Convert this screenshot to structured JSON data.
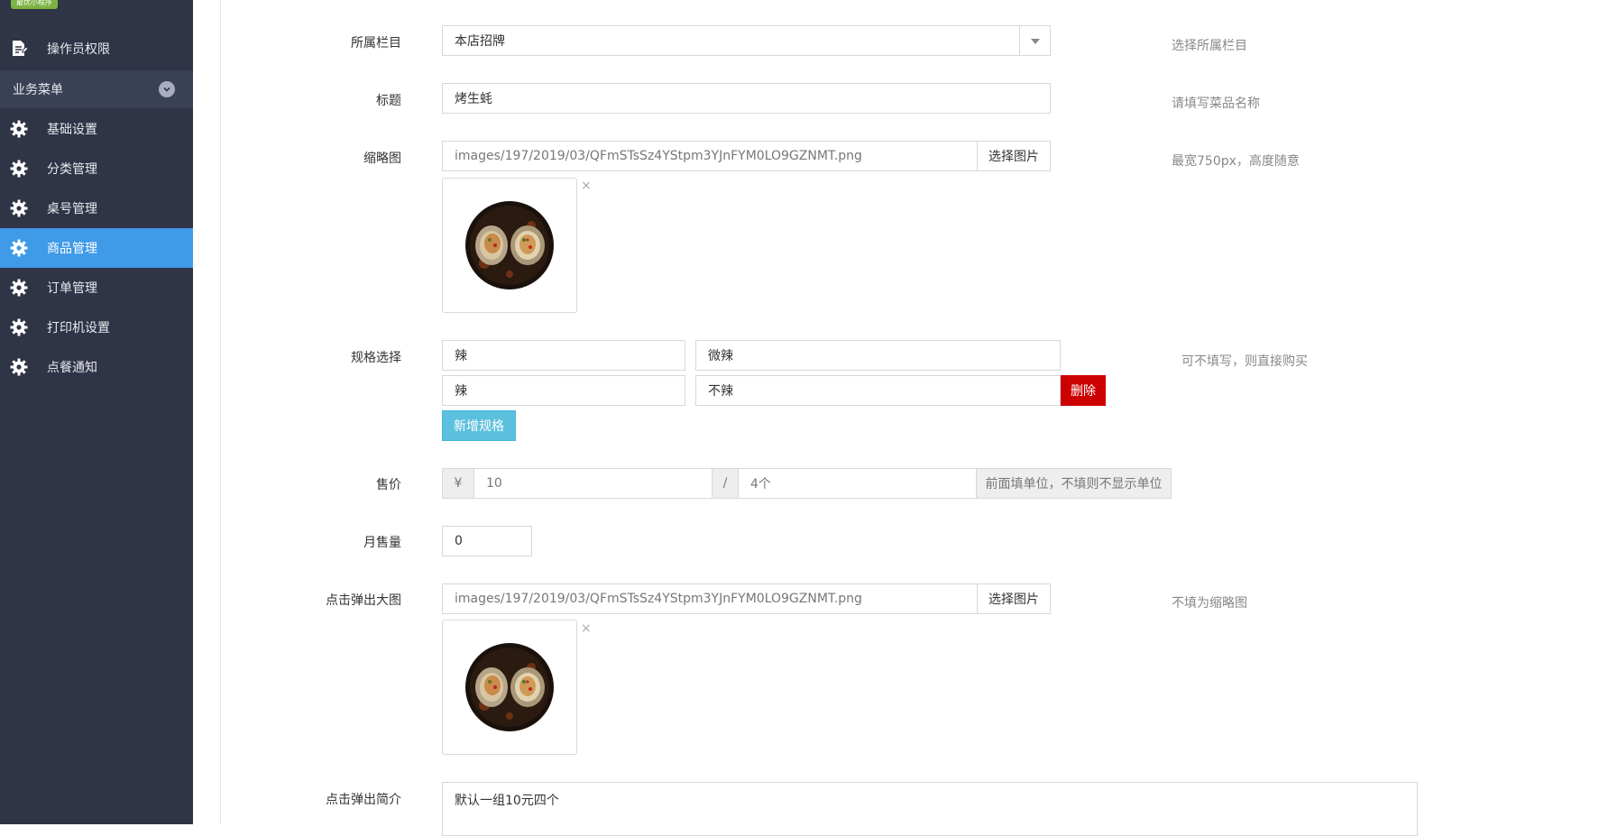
{
  "sidebar": {
    "badge": "最优小程序",
    "top_item": "操作员权限",
    "group_label": "业务菜单",
    "items": [
      {
        "label": "基础设置",
        "icon": "gear-icon"
      },
      {
        "label": "分类管理",
        "icon": "gear-icon"
      },
      {
        "label": "桌号管理",
        "icon": "gear-icon"
      },
      {
        "label": "商品管理",
        "icon": "gear-icon",
        "active": true
      },
      {
        "label": "订单管理",
        "icon": "gear-icon"
      },
      {
        "label": "打印机设置",
        "icon": "gear-icon"
      },
      {
        "label": "点餐通知",
        "icon": "gear-icon"
      }
    ]
  },
  "form": {
    "category": {
      "label": "所属栏目",
      "value": "本店招牌",
      "hint": "选择所属栏目"
    },
    "title": {
      "label": "标题",
      "value": "烤生蚝",
      "hint": "请填写菜品名称"
    },
    "thumbnail": {
      "label": "缩略图",
      "path": "images/197/2019/03/QFmSTsSz4YStpm3YJnFYM0LO9GZNMT.png",
      "button": "选择图片",
      "hint": "最宽750px，高度随意",
      "remove": "×"
    },
    "specs": {
      "label": "规格选择",
      "rows": [
        {
          "name": "辣",
          "value": "微辣"
        },
        {
          "name": "辣",
          "value": "不辣"
        }
      ],
      "delete_button": "删除",
      "add_button": "新增规格",
      "hint": "可不填写，则直接购买"
    },
    "price": {
      "label": "售价",
      "currency": "¥",
      "value": "10",
      "sep": "/",
      "unit": "4个",
      "hint": "前面填单位，不填则不显示单位"
    },
    "monthly_sales": {
      "label": "月售量",
      "value": "0"
    },
    "popup_image": {
      "label": "点击弹出大图",
      "path": "images/197/2019/03/QFmSTsSz4YStpm3YJnFYM0LO9GZNMT.png",
      "button": "选择图片",
      "hint": "不填为缩略图",
      "remove": "×"
    },
    "popup_intro": {
      "label": "点击弹出简介",
      "value": "默认一组10元四个"
    }
  },
  "colors": {
    "sidebar_bg": "#2f3447",
    "active": "#3f9ae8",
    "delete": "#cc0000",
    "add": "#5bc0de"
  }
}
